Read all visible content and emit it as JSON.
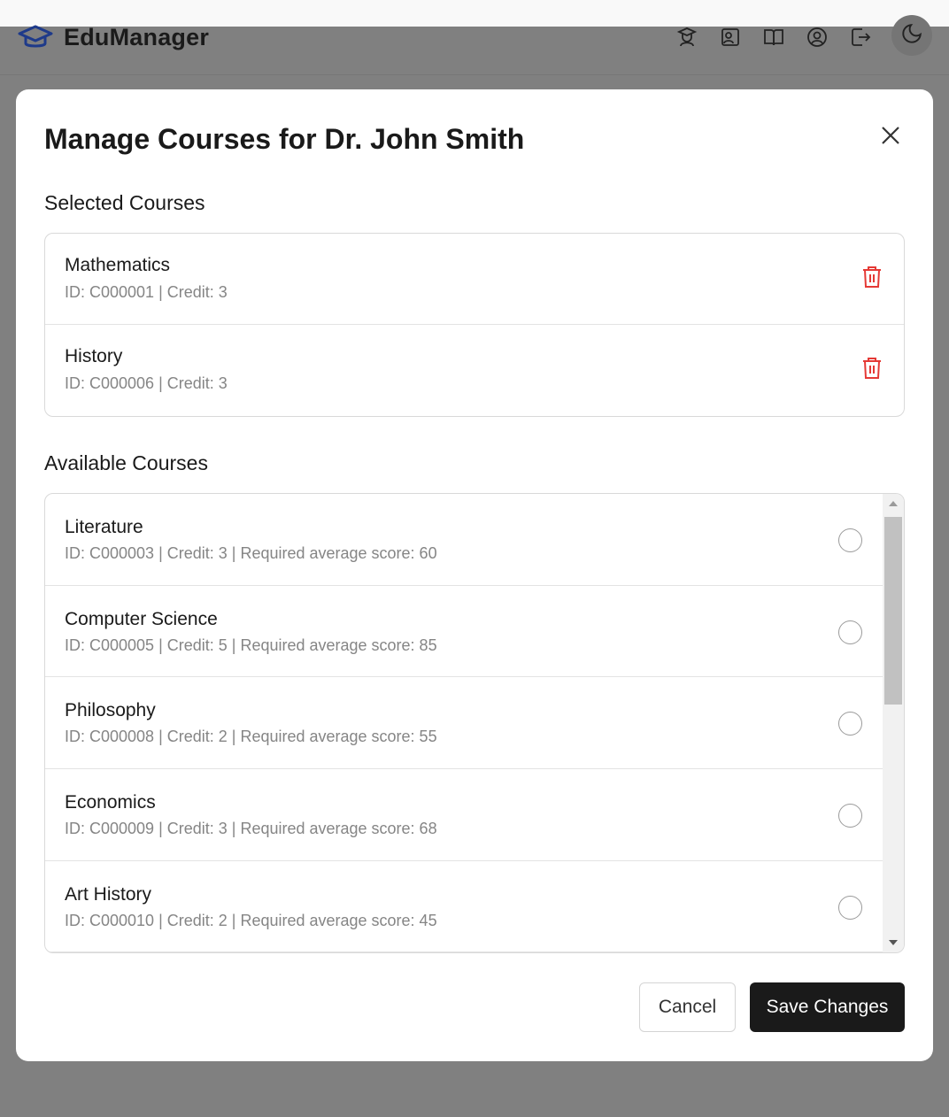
{
  "app": {
    "name": "EduManager",
    "logo_icon": "graduation-cap-icon",
    "brand_color": "#1e3a8a"
  },
  "nav": {
    "icons": [
      "student-icon",
      "teacher-icon",
      "book-icon",
      "user-circle-icon",
      "logout-icon"
    ],
    "theme_toggle_icon": "moon-icon"
  },
  "modal": {
    "title": "Manage Courses for Dr. John Smith",
    "close_icon": "close-icon",
    "selected_title": "Selected Courses",
    "available_title": "Available Courses",
    "selected_courses": [
      {
        "name": "Mathematics",
        "meta": "ID: C000001 | Credit: 3"
      },
      {
        "name": "History",
        "meta": "ID: C000006 | Credit: 3"
      }
    ],
    "available_courses": [
      {
        "name": "Literature",
        "meta": "ID: C000003 | Credit: 3 | Required average score: 60"
      },
      {
        "name": "Computer Science",
        "meta": "ID: C000005 | Credit: 5 | Required average score: 85"
      },
      {
        "name": "Philosophy",
        "meta": "ID: C000008 | Credit: 2 | Required average score: 55"
      },
      {
        "name": "Economics",
        "meta": "ID: C000009 | Credit: 3 | Required average score: 68"
      },
      {
        "name": "Art History",
        "meta": "ID: C000010 | Credit: 2 | Required average score: 45"
      }
    ],
    "cancel_label": "Cancel",
    "save_label": "Save Changes",
    "delete_color": "#e53935"
  }
}
